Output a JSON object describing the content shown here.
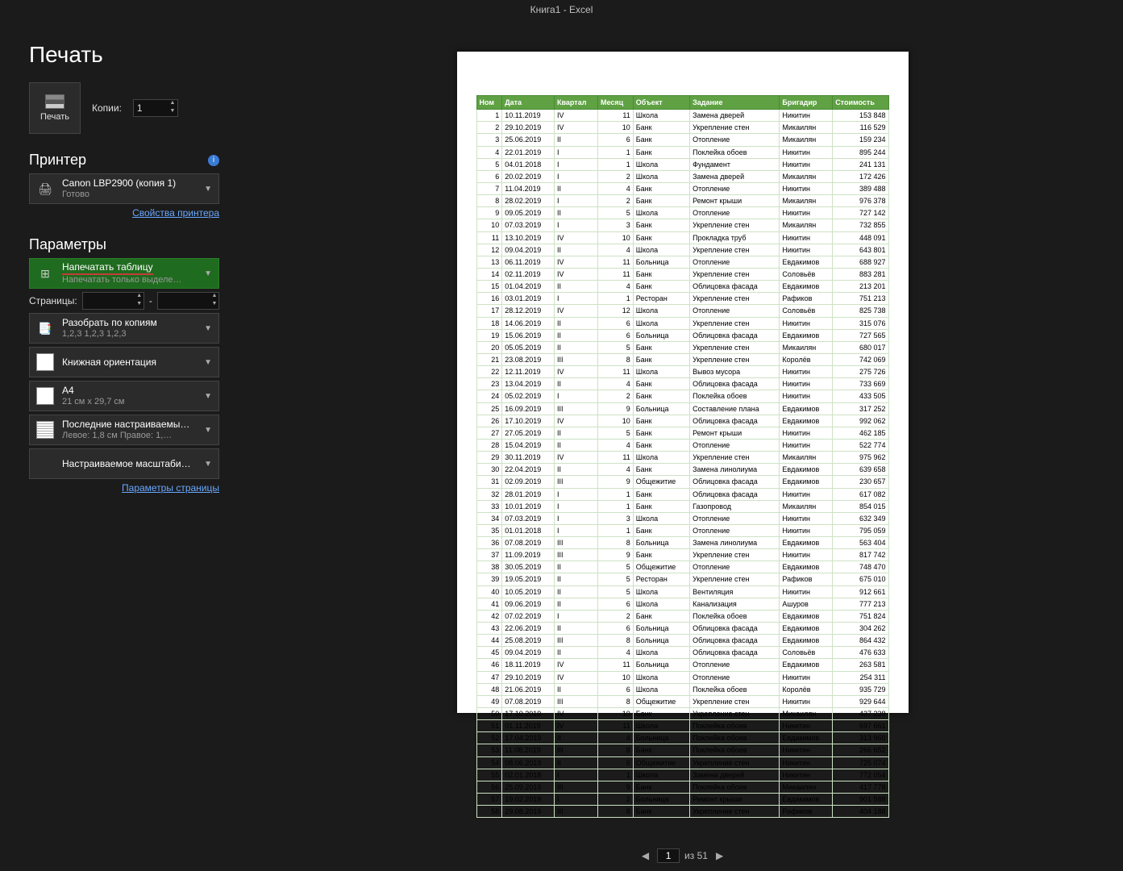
{
  "app_title": "Книга1  -  Excel",
  "page": {
    "title": "Печать"
  },
  "print_button": {
    "label": "Печать"
  },
  "copies": {
    "label": "Копии:",
    "value": "1"
  },
  "printer_section": {
    "title": "Принтер"
  },
  "printer_dd": {
    "line1": "Canon LBP2900 (копия 1)",
    "line2": "Готово"
  },
  "printer_link": "Свойства принтера",
  "params_section": {
    "title": "Параметры"
  },
  "print_area_dd": {
    "line1": "Напечатать таблицу",
    "line2": "Напечатать только выделе…"
  },
  "pages": {
    "label": "Страницы:",
    "sep": "-"
  },
  "collate_dd": {
    "line1": "Разобрать по копиям",
    "line2": "1,2,3    1,2,3    1,2,3"
  },
  "orient_dd": {
    "line1": "Книжная ориентация"
  },
  "size_dd": {
    "line1": "A4",
    "line2": "21 см x 29,7 см"
  },
  "margins_dd": {
    "line1": "Последние настраиваемы…",
    "line2": "Левое:  1,8 см    Правое:  1,…"
  },
  "scale_dd": {
    "line1": "Настраиваемое масштаби…"
  },
  "page_setup_link": "Параметры страницы",
  "nav": {
    "of": "из 51",
    "page": "1"
  },
  "table": {
    "headers": [
      "Ном",
      "Дата",
      "Квартал",
      "Месяц",
      "Объект",
      "Задание",
      "Бригадир",
      "Стоимость"
    ],
    "rows": [
      [
        "1",
        "10.11.2019",
        "IV",
        "11",
        "Школа",
        "Замена дверей",
        "Никитин",
        "153 848"
      ],
      [
        "2",
        "29.10.2019",
        "IV",
        "10",
        "Банк",
        "Укрепление стен",
        "Микаилян",
        "116 529"
      ],
      [
        "3",
        "25.06.2019",
        "II",
        "6",
        "Банк",
        "Отопление",
        "Микаилян",
        "159 234"
      ],
      [
        "4",
        "22.01.2019",
        "I",
        "1",
        "Банк",
        "Поклейка обоев",
        "Никитин",
        "895 244"
      ],
      [
        "5",
        "04.01.2018",
        "I",
        "1",
        "Школа",
        "Фундамент",
        "Никитин",
        "241 131"
      ],
      [
        "6",
        "20.02.2019",
        "I",
        "2",
        "Школа",
        "Замена дверей",
        "Микаилян",
        "172 426"
      ],
      [
        "7",
        "11.04.2019",
        "II",
        "4",
        "Банк",
        "Отопление",
        "Никитин",
        "389 488"
      ],
      [
        "8",
        "28.02.2019",
        "I",
        "2",
        "Банк",
        "Ремонт крыши",
        "Микаилян",
        "976 378"
      ],
      [
        "9",
        "09.05.2019",
        "II",
        "5",
        "Школа",
        "Отопление",
        "Никитин",
        "727 142"
      ],
      [
        "10",
        "07.03.2019",
        "I",
        "3",
        "Банк",
        "Укрепление стен",
        "Микаилян",
        "732 855"
      ],
      [
        "11",
        "13.10.2019",
        "IV",
        "10",
        "Банк",
        "Прокладка труб",
        "Никитин",
        "448 091"
      ],
      [
        "12",
        "09.04.2019",
        "II",
        "4",
        "Школа",
        "Укрепление стен",
        "Никитин",
        "643 801"
      ],
      [
        "13",
        "06.11.2019",
        "IV",
        "11",
        "Больница",
        "Отопление",
        "Евдакимов",
        "688 927"
      ],
      [
        "14",
        "02.11.2019",
        "IV",
        "11",
        "Банк",
        "Укрепление стен",
        "Соловьёв",
        "883 281"
      ],
      [
        "15",
        "01.04.2019",
        "II",
        "4",
        "Банк",
        "Облицовка фасада",
        "Евдакимов",
        "213 201"
      ],
      [
        "16",
        "03.01.2019",
        "I",
        "1",
        "Ресторан",
        "Укрепление стен",
        "Рафиков",
        "751 213"
      ],
      [
        "17",
        "28.12.2019",
        "IV",
        "12",
        "Школа",
        "Отопление",
        "Соловьёв",
        "825 738"
      ],
      [
        "18",
        "14.06.2019",
        "II",
        "6",
        "Школа",
        "Укрепление стен",
        "Никитин",
        "315 076"
      ],
      [
        "19",
        "15.06.2019",
        "II",
        "6",
        "Больница",
        "Облицовка фасада",
        "Евдакимов",
        "727 565"
      ],
      [
        "20",
        "05.05.2019",
        "II",
        "5",
        "Банк",
        "Укрепление стен",
        "Микаилян",
        "680 017"
      ],
      [
        "21",
        "23.08.2019",
        "III",
        "8",
        "Банк",
        "Укрепление стен",
        "Королёв",
        "742 069"
      ],
      [
        "22",
        "12.11.2019",
        "IV",
        "11",
        "Школа",
        "Вывоз мусора",
        "Никитин",
        "275 726"
      ],
      [
        "23",
        "13.04.2019",
        "II",
        "4",
        "Банк",
        "Облицовка фасада",
        "Никитин",
        "733 669"
      ],
      [
        "24",
        "05.02.2019",
        "I",
        "2",
        "Банк",
        "Поклейка обоев",
        "Никитин",
        "433 505"
      ],
      [
        "25",
        "16.09.2019",
        "III",
        "9",
        "Больница",
        "Составление плана",
        "Евдакимов",
        "317 252"
      ],
      [
        "26",
        "17.10.2019",
        "IV",
        "10",
        "Банк",
        "Облицовка фасада",
        "Евдакимов",
        "992 062"
      ],
      [
        "27",
        "27.05.2019",
        "II",
        "5",
        "Банк",
        "Ремонт крыши",
        "Никитин",
        "462 185"
      ],
      [
        "28",
        "15.04.2019",
        "II",
        "4",
        "Банк",
        "Отопление",
        "Никитин",
        "522 774"
      ],
      [
        "29",
        "30.11.2019",
        "IV",
        "11",
        "Школа",
        "Укрепление стен",
        "Микаилян",
        "975 962"
      ],
      [
        "30",
        "22.04.2019",
        "II",
        "4",
        "Банк",
        "Замена линолиума",
        "Евдакимов",
        "639 658"
      ],
      [
        "31",
        "02.09.2019",
        "III",
        "9",
        "Общежитие",
        "Облицовка фасада",
        "Евдакимов",
        "230 657"
      ],
      [
        "32",
        "28.01.2019",
        "I",
        "1",
        "Банк",
        "Облицовка фасада",
        "Никитин",
        "617 082"
      ],
      [
        "33",
        "10.01.2019",
        "I",
        "1",
        "Банк",
        "Газопровод",
        "Микаилян",
        "854 015"
      ],
      [
        "34",
        "07.03.2019",
        "I",
        "3",
        "Школа",
        "Отопление",
        "Никитин",
        "632 349"
      ],
      [
        "35",
        "01.01.2018",
        "I",
        "1",
        "Банк",
        "Отопление",
        "Никитин",
        "795 059"
      ],
      [
        "36",
        "07.08.2019",
        "III",
        "8",
        "Больница",
        "Замена линолиума",
        "Евдакимов",
        "563 404"
      ],
      [
        "37",
        "11.09.2019",
        "III",
        "9",
        "Банк",
        "Укрепление стен",
        "Никитин",
        "817 742"
      ],
      [
        "38",
        "30.05.2019",
        "II",
        "5",
        "Общежитие",
        "Отопление",
        "Евдакимов",
        "748 470"
      ],
      [
        "39",
        "19.05.2019",
        "II",
        "5",
        "Ресторан",
        "Укрепление стен",
        "Рафиков",
        "675 010"
      ],
      [
        "40",
        "10.05.2019",
        "II",
        "5",
        "Школа",
        "Вентиляция",
        "Никитин",
        "912 661"
      ],
      [
        "41",
        "09.06.2019",
        "II",
        "6",
        "Школа",
        "Канализация",
        "Ашуров",
        "777 213"
      ],
      [
        "42",
        "07.02.2019",
        "I",
        "2",
        "Банк",
        "Поклейка обоев",
        "Евдакимов",
        "751 824"
      ],
      [
        "43",
        "22.06.2019",
        "II",
        "6",
        "Больница",
        "Облицовка фасада",
        "Евдакимов",
        "304 262"
      ],
      [
        "44",
        "25.08.2019",
        "III",
        "8",
        "Больница",
        "Облицовка фасада",
        "Евдакимов",
        "864 432"
      ],
      [
        "45",
        "09.04.2019",
        "II",
        "4",
        "Школа",
        "Облицовка фасада",
        "Соловьёв",
        "476 633"
      ],
      [
        "46",
        "18.11.2019",
        "IV",
        "11",
        "Больница",
        "Отопление",
        "Евдакимов",
        "263 581"
      ],
      [
        "47",
        "29.10.2019",
        "IV",
        "10",
        "Школа",
        "Отопление",
        "Никитин",
        "254 311"
      ],
      [
        "48",
        "21.06.2019",
        "II",
        "6",
        "Школа",
        "Поклейка обоев",
        "Королёв",
        "935 729"
      ],
      [
        "49",
        "07.08.2019",
        "III",
        "8",
        "Общежитие",
        "Укрепление стен",
        "Никитин",
        "929 644"
      ],
      [
        "50",
        "17.10.2019",
        "IV",
        "10",
        "Банк",
        "Укрепление стен",
        "Микаилян",
        "437 238"
      ],
      [
        "51",
        "01.11.2019",
        "IV",
        "11",
        "Школа",
        "Поклейка обоев",
        "Никитин",
        "697 661"
      ],
      [
        "52",
        "17.04.2019",
        "II",
        "4",
        "Больница",
        "Поклейка обоев",
        "Евдакимов",
        "313 960"
      ],
      [
        "53",
        "11.08.2019",
        "III",
        "8",
        "Банк",
        "Поклейка обоев",
        "Никитин",
        "266 652"
      ],
      [
        "54",
        "08.06.2019",
        "II",
        "6",
        "Общежитие",
        "Укрепление стен",
        "Никитин",
        "725 074"
      ],
      [
        "55",
        "02.01.2018",
        "I",
        "1",
        "Школа",
        "Замена дверей",
        "Никитин",
        "772 054"
      ],
      [
        "56",
        "25.09.2019",
        "III",
        "9",
        "Банк",
        "Поклейка обоев",
        "Микаилян",
        "417 778"
      ],
      [
        "57",
        "19.02.2019",
        "I",
        "2",
        "Больница",
        "Ремонт крыши",
        "Евдакимов",
        "901 588"
      ],
      [
        "58",
        "29.08.2019",
        "III",
        "8",
        "Банк",
        "Укрепление стен",
        "Рафиков",
        "404 188"
      ]
    ]
  }
}
